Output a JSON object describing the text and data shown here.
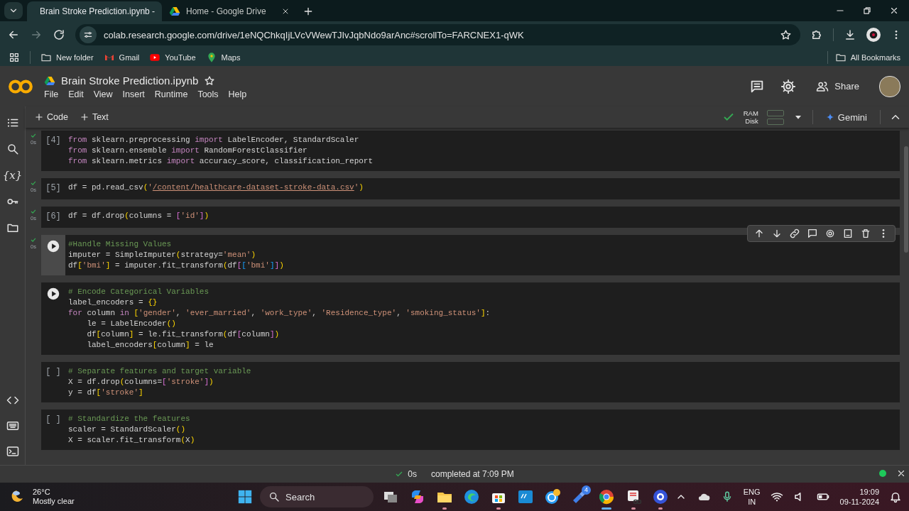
{
  "browser": {
    "tabs": [
      {
        "kind": "colab",
        "title": "Brain Stroke Prediction.ipynb -",
        "selected": true
      },
      {
        "kind": "drive",
        "title": "Home - Google Drive",
        "selected": false
      }
    ],
    "forward_disabled": true,
    "url": "colab.research.google.com/drive/1eNQChkqIjLVcVWewTJIvJqbNdo9arAnc#scrollTo=FARCNEX1-qWK",
    "bookmarks": [
      {
        "kind": "folder",
        "label": "New folder"
      },
      {
        "kind": "gmail",
        "label": "Gmail"
      },
      {
        "kind": "youtube",
        "label": "YouTube"
      },
      {
        "kind": "maps",
        "label": "Maps"
      }
    ],
    "all_bookmarks": "All Bookmarks"
  },
  "notebook": {
    "title": "Brain Stroke Prediction.ipynb",
    "menu": [
      "File",
      "Edit",
      "View",
      "Insert",
      "Runtime",
      "Tools",
      "Help"
    ],
    "share": "Share",
    "add_buttons": [
      "Code",
      "Text"
    ],
    "ram_label": "RAM",
    "disk_label": "Disk",
    "gemini": "Gemini"
  },
  "sidebar": {
    "variables_glyph": "{x}"
  },
  "cells": [
    {
      "prompt": "[4]",
      "done": true,
      "time": "0s",
      "selected": false,
      "lines": [
        [
          {
            "text": "from",
            "kind": "keyword"
          },
          {
            "text": " sklearn.preprocessing ",
            "kind": "plain"
          },
          {
            "text": "import",
            "kind": "keyword"
          },
          {
            "text": " LabelEncoder, StandardScaler",
            "kind": "plain"
          }
        ],
        [
          {
            "text": "from",
            "kind": "keyword"
          },
          {
            "text": " sklearn.ensemble ",
            "kind": "plain"
          },
          {
            "text": "import",
            "kind": "keyword"
          },
          {
            "text": " RandomForestClassifier",
            "kind": "plain"
          }
        ],
        [
          {
            "text": "from",
            "kind": "keyword"
          },
          {
            "text": " sklearn.metrics ",
            "kind": "plain"
          },
          {
            "text": "import",
            "kind": "keyword"
          },
          {
            "text": " accuracy_score, classification_report",
            "kind": "plain"
          }
        ]
      ]
    },
    {
      "prompt": "[5]",
      "done": true,
      "time": "0s",
      "selected": false,
      "lines": [
        [
          {
            "text": "df = pd.read_csv",
            "kind": "plain"
          },
          {
            "text": "(",
            "kind": "bracket"
          },
          {
            "text": "'",
            "kind": "string"
          },
          {
            "text": "/content/healthcare-dataset-stroke-data.csv",
            "kind": "path"
          },
          {
            "text": "'",
            "kind": "string"
          },
          {
            "text": ")",
            "kind": "bracket"
          }
        ]
      ]
    },
    {
      "prompt": "[6]",
      "done": true,
      "time": "0s",
      "selected": false,
      "lines": [
        [
          {
            "text": "df = df.drop",
            "kind": "plain"
          },
          {
            "text": "(",
            "kind": "bracket"
          },
          {
            "text": "columns = ",
            "kind": "plain"
          },
          {
            "text": "[",
            "kind": "bracket2"
          },
          {
            "text": "'id'",
            "kind": "string"
          },
          {
            "text": "]",
            "kind": "bracket2"
          },
          {
            "text": ")",
            "kind": "bracket"
          }
        ]
      ]
    },
    {
      "done": true,
      "time": "0s",
      "selected": true,
      "lines": [
        [
          {
            "text": "#Handle Missing Values",
            "kind": "comment"
          }
        ],
        [
          {
            "text": "imputer = SimpleImputer",
            "kind": "plain"
          },
          {
            "text": "(",
            "kind": "bracket"
          },
          {
            "text": "strategy=",
            "kind": "plain"
          },
          {
            "text": "'mean'",
            "kind": "string"
          },
          {
            "text": ")",
            "kind": "bracket"
          }
        ],
        [
          {
            "text": "df",
            "kind": "plain"
          },
          {
            "text": "[",
            "kind": "bracket"
          },
          {
            "text": "'bmi'",
            "kind": "string"
          },
          {
            "text": "]",
            "kind": "bracket"
          },
          {
            "text": " = imputer.fit_transform",
            "kind": "plain"
          },
          {
            "text": "(",
            "kind": "bracket"
          },
          {
            "text": "df",
            "kind": "plain"
          },
          {
            "text": "[",
            "kind": "bracket2"
          },
          {
            "text": "[",
            "kind": "bracket3"
          },
          {
            "text": "'bmi'",
            "kind": "string"
          },
          {
            "text": "]",
            "kind": "bracket3"
          },
          {
            "text": "]",
            "kind": "bracket2"
          },
          {
            "text": ")",
            "kind": "bracket"
          }
        ]
      ]
    },
    {
      "done": false,
      "selected": false,
      "lines": [
        [
          {
            "text": "# Encode Categorical Variables",
            "kind": "comment"
          }
        ],
        [
          {
            "text": "label_encoders = ",
            "kind": "plain"
          },
          {
            "text": "{}",
            "kind": "bracket"
          }
        ],
        [
          {
            "text": "for",
            "kind": "keyword"
          },
          {
            "text": " column ",
            "kind": "plain"
          },
          {
            "text": "in",
            "kind": "keyword"
          },
          {
            "text": " [",
            "kind": "bracket"
          },
          {
            "text": "'gender'",
            "kind": "string"
          },
          {
            "text": ", ",
            "kind": "plain"
          },
          {
            "text": "'ever_married'",
            "kind": "string"
          },
          {
            "text": ", ",
            "kind": "plain"
          },
          {
            "text": "'work_type'",
            "kind": "string"
          },
          {
            "text": ", ",
            "kind": "plain"
          },
          {
            "text": "'Residence_type'",
            "kind": "string"
          },
          {
            "text": ", ",
            "kind": "plain"
          },
          {
            "text": "'smoking_status'",
            "kind": "string"
          },
          {
            "text": "]",
            "kind": "bracket"
          },
          {
            "text": ":",
            "kind": "plain"
          }
        ],
        [
          {
            "text": "    le = LabelEncoder",
            "kind": "plain"
          },
          {
            "text": "()",
            "kind": "bracket"
          }
        ],
        [
          {
            "text": "    df",
            "kind": "plain"
          },
          {
            "text": "[",
            "kind": "bracket"
          },
          {
            "text": "column",
            "kind": "plain"
          },
          {
            "text": "]",
            "kind": "bracket"
          },
          {
            "text": " = le.fit_transform",
            "kind": "plain"
          },
          {
            "text": "(",
            "kind": "bracket"
          },
          {
            "text": "df",
            "kind": "plain"
          },
          {
            "text": "[",
            "kind": "bracket2"
          },
          {
            "text": "column",
            "kind": "plain"
          },
          {
            "text": "]",
            "kind": "bracket2"
          },
          {
            "text": ")",
            "kind": "bracket"
          }
        ],
        [
          {
            "text": "    label_encoders",
            "kind": "plain"
          },
          {
            "text": "[",
            "kind": "bracket"
          },
          {
            "text": "column",
            "kind": "plain"
          },
          {
            "text": "]",
            "kind": "bracket"
          },
          {
            "text": " = le",
            "kind": "plain"
          }
        ]
      ]
    },
    {
      "prompt": "[ ]",
      "done": false,
      "selected": false,
      "lines": [
        [
          {
            "text": "# Separate features and target variable",
            "kind": "comment"
          }
        ],
        [
          {
            "text": "X = df.drop",
            "kind": "plain"
          },
          {
            "text": "(",
            "kind": "bracket"
          },
          {
            "text": "columns=",
            "kind": "plain"
          },
          {
            "text": "[",
            "kind": "bracket2"
          },
          {
            "text": "'stroke'",
            "kind": "string"
          },
          {
            "text": "]",
            "kind": "bracket2"
          },
          {
            "text": ")",
            "kind": "bracket"
          }
        ],
        [
          {
            "text": "y = df",
            "kind": "plain"
          },
          {
            "text": "[",
            "kind": "bracket"
          },
          {
            "text": "'stroke'",
            "kind": "string"
          },
          {
            "text": "]",
            "kind": "bracket"
          }
        ]
      ]
    },
    {
      "prompt": "[ ]",
      "done": false,
      "selected": false,
      "lines": [
        [
          {
            "text": "# Standardize the features",
            "kind": "comment"
          }
        ],
        [
          {
            "text": "scaler = StandardScaler",
            "kind": "plain"
          },
          {
            "text": "()",
            "kind": "bracket"
          }
        ],
        [
          {
            "text": "X = scaler.fit_transform",
            "kind": "plain"
          },
          {
            "text": "(",
            "kind": "bracket"
          },
          {
            "text": "X",
            "kind": "plain"
          },
          {
            "text": ")",
            "kind": "bracket"
          }
        ]
      ]
    }
  ],
  "status_bar": {
    "time": "0s",
    "message": "completed at 7:09 PM"
  },
  "taskbar": {
    "weather": {
      "temp": "26°C",
      "condition": "Mostly clear"
    },
    "search": {
      "placeholder": "Search"
    },
    "apps": [
      {
        "kind": "taskview",
        "open": false,
        "active": false
      },
      {
        "kind": "copilot",
        "open": false,
        "active": false
      },
      {
        "kind": "explorer",
        "open": true,
        "active": false
      },
      {
        "kind": "edge",
        "open": false,
        "active": false
      },
      {
        "kind": "store",
        "open": true,
        "active": false
      },
      {
        "kind": "hp",
        "open": false,
        "active": false
      },
      {
        "kind": "help",
        "open": false,
        "active": false
      },
      {
        "kind": "tool",
        "open": false,
        "active": false,
        "badge": "4"
      },
      {
        "kind": "chrome",
        "open": true,
        "active": true
      },
      {
        "kind": "snip",
        "open": true,
        "active": false
      },
      {
        "kind": "disc",
        "open": true,
        "active": false
      }
    ],
    "language": "ENG",
    "region": "IN",
    "time": "19:09",
    "date": "09-11-2024"
  }
}
